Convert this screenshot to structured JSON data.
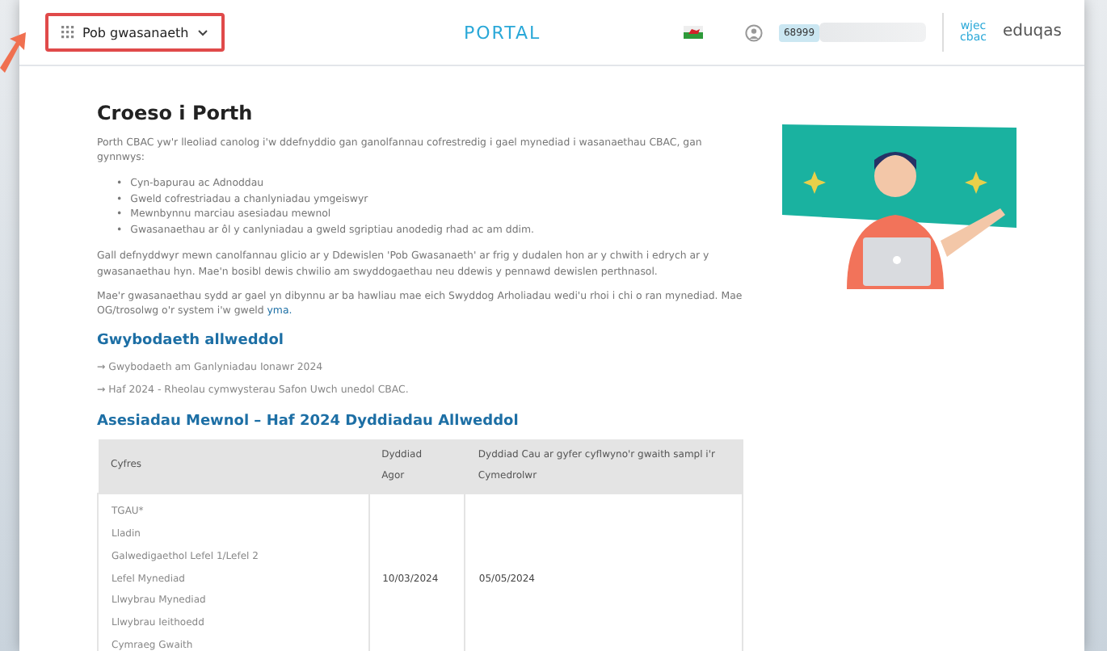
{
  "header": {
    "menu_label": "Pob gwasanaeth",
    "menu_highlighted": true,
    "portal": "PORTAL",
    "user_code": "68999",
    "logos": [
      {
        "kind": "wjec",
        "lines": [
          "wjec",
          "cbac"
        ]
      },
      {
        "kind": "eduqas",
        "lines": [
          "eduqas"
        ]
      }
    ]
  },
  "welcome": {
    "title": "Croeso i Porth",
    "intro": "Porth CBAC yw'r lleoliad canolog i'w ddefnyddio gan ganolfannau cofrestredig i gael mynediad i wasanaethau CBAC, gan gynnwys:",
    "bullet_marker": "•",
    "bullets": [
      "Cyn-bapurau ac Adnoddau",
      "Gweld cofrestriadau a chanlyniadau ymgeiswyr",
      "Mewnbynnu marciau asesiadau mewnol",
      "Gwasanaethau ar ôl y canlyniadau a gweld sgriptiau anodedig rhad ac am ddim."
    ],
    "para_1": "Gall defnyddwyr mewn canolfannau glicio ar y Ddewislen 'Pob Gwasanaeth' ar frig y dudalen hon ar y chwith i edrych ar y gwasanaethau hyn. Mae'n bosibl dewis chwilio am swyddogaethau neu ddewis y pennawd dewislen perthnasol.",
    "para_2": "Mae'r gwasanaethau sydd ar gael yn dibynnu ar ba hawliau mae eich Swyddog Arholiadau wedi'u rhoi i chi o ran mynediad. Mae OG/trosolwg o'r system i'w gweld",
    "para_2_link": "yma."
  },
  "key_info": {
    "title": "Gwybodaeth allweddol",
    "link_arrow": "→",
    "links": [
      "Gwybodaeth am Ganlyniadau Ionawr 2024",
      "Haf 2024 - Rheolau cymwysterau Safon Uwch unedol CBAC."
    ]
  },
  "assessments": {
    "title": "Asesiadau Mewnol – Haf 2024 Dyddiadau Allweddol",
    "columns": [
      "Cyfres",
      [
        "Dyddiad",
        "Agor"
      ],
      [
        "Dyddiad Cau ar gyfer cyflwyno'r gwaith sampl i'r",
        "Cymedrolwr"
      ]
    ],
    "rows": [
      {
        "series": [
          "TGAU*",
          "Lladin",
          "Galwedigaethol Lefel 1/Lefel 2",
          "Lefel Mynediad",
          "Llwybrau Mynediad",
          "Llwybrau Ieithoedd",
          "Cymraeg Gwaith"
        ],
        "open": "10/03/2024",
        "close": "05/05/2024"
      }
    ]
  }
}
